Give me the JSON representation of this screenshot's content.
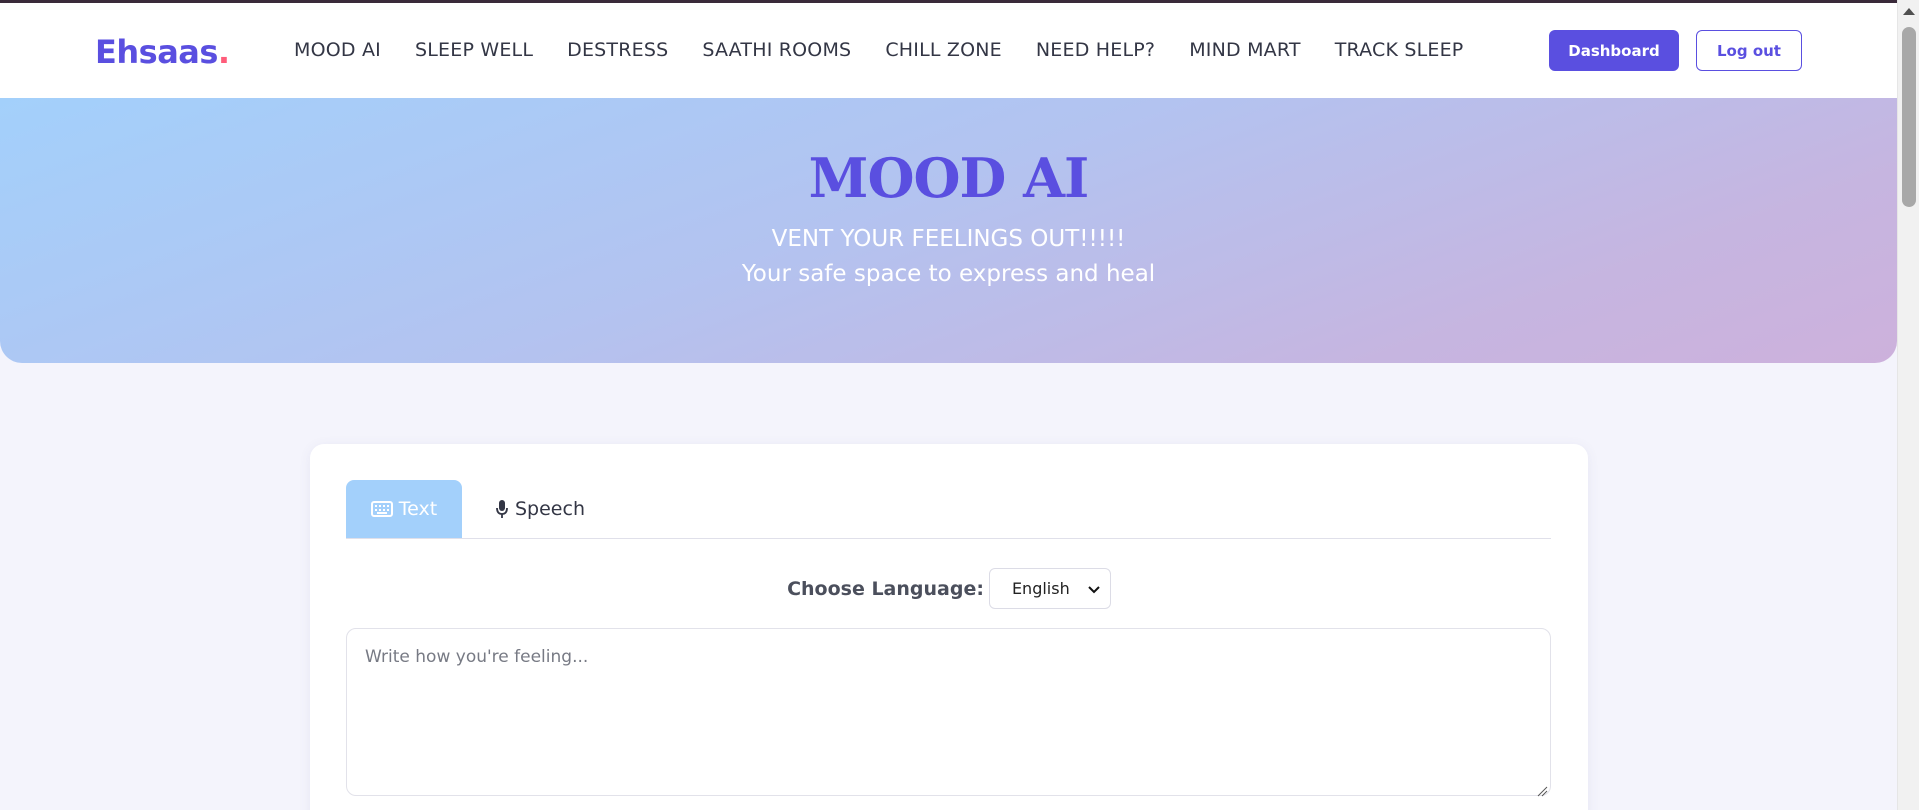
{
  "brand": {
    "name": "Ehsaas",
    "dot": ".",
    "accent": "#5a4fe0",
    "dot_color": "#ff5c7a"
  },
  "nav": {
    "links": [
      "MOOD AI",
      "SLEEP WELL",
      "DESTRESS",
      "SAATHI ROOMS",
      "CHILL ZONE",
      "NEED HELP?",
      "MIND MART",
      "TRACK SLEEP"
    ],
    "dashboard_label": "Dashboard",
    "logout_label": "Log out"
  },
  "hero": {
    "title": "MOOD AI",
    "subtitle": "VENT YOUR FEELINGS OUT!!!!!",
    "tagline": "Your safe space to express and heal"
  },
  "input_panel": {
    "tabs": [
      {
        "label": "Text",
        "icon": "keyboard-icon",
        "active": true
      },
      {
        "label": "Speech",
        "icon": "microphone-icon",
        "active": false
      }
    ],
    "language_label": "Choose Language:",
    "language_value": "English",
    "textarea_placeholder": "Write how you're feeling...",
    "textarea_value": ""
  }
}
